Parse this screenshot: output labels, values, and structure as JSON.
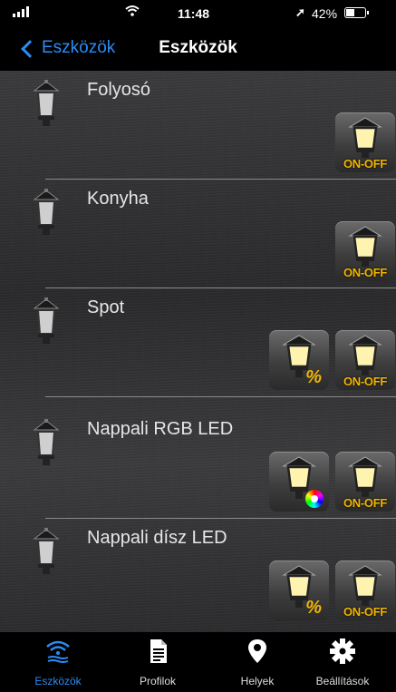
{
  "status": {
    "time": "11:48",
    "battery": "42%",
    "location_arrow": "➚"
  },
  "nav": {
    "back_label": "Eszközök",
    "title": "Eszközök"
  },
  "devices": [
    {
      "name": "Folyosó"
    },
    {
      "name": "Konyha"
    },
    {
      "name": "Spot"
    },
    {
      "name": "Nappali RGB LED"
    },
    {
      "name": "Nappali dísz LED"
    }
  ],
  "controls": {
    "onoff_label": "ON-OFF",
    "dim_label": "%"
  },
  "tabs": [
    {
      "label": "Eszközök",
      "icon": "wifi-waves-icon",
      "active": true
    },
    {
      "label": "Profilok",
      "icon": "document-icon",
      "active": false
    },
    {
      "label": "Helyek",
      "icon": "location-pin-icon",
      "active": false
    },
    {
      "label": "Beállítások",
      "icon": "gear-icon",
      "active": false
    }
  ],
  "colors": {
    "accent": "#2a8cf5",
    "onoff": "#f2b600"
  }
}
